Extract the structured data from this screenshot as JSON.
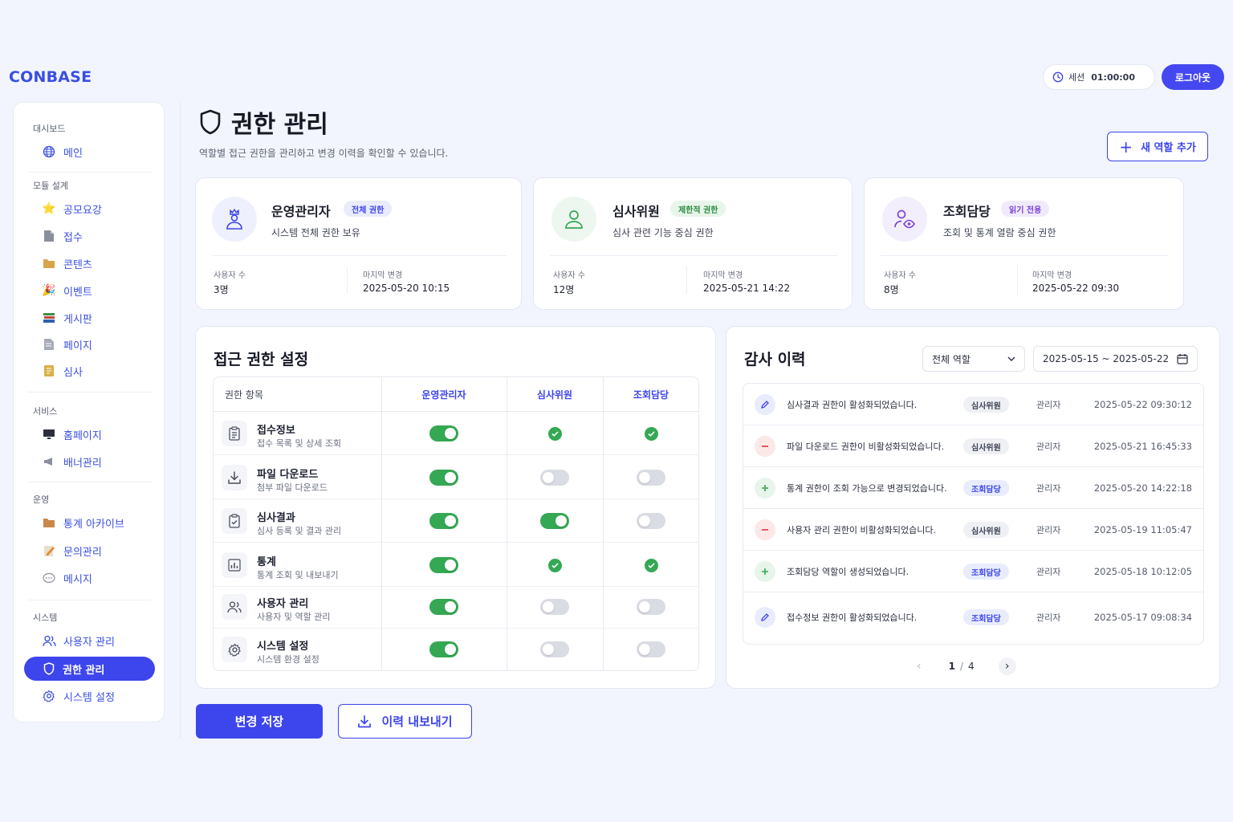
{
  "app": {
    "logo": "CONBASE"
  },
  "header": {
    "session_label": "세션",
    "session_time": "01:00:00",
    "logout_label": "로그아웃"
  },
  "sidebar": {
    "sections": [
      "대시보드",
      "모듈 설계",
      "서비스",
      "운영",
      "시스템"
    ],
    "items": [
      {
        "label": "메인",
        "icon": "globe-icon"
      },
      {
        "label": "공모요강",
        "icon": "star-icon"
      },
      {
        "label": "접수",
        "icon": "document-icon"
      },
      {
        "label": "콘텐츠",
        "icon": "folder-icon"
      },
      {
        "label": "이벤트",
        "icon": "party-icon"
      },
      {
        "label": "게시판",
        "icon": "books-icon"
      },
      {
        "label": "페이지",
        "icon": "page-icon"
      },
      {
        "label": "심사",
        "icon": "note-icon"
      },
      {
        "label": "홈페이지",
        "icon": "monitor-icon"
      },
      {
        "label": "배너관리",
        "icon": "megaphone-icon"
      },
      {
        "label": "통계 아카이브",
        "icon": "archive-icon"
      },
      {
        "label": "문의관리",
        "icon": "memo-icon"
      },
      {
        "label": "메시지",
        "icon": "speech-bubble-icon"
      },
      {
        "label": "사용자 관리",
        "icon": "users-icon"
      },
      {
        "label": "권한 관리",
        "icon": "shield-icon"
      },
      {
        "label": "시스템 설정",
        "icon": "gear-icon"
      }
    ],
    "active": "권한 관리"
  },
  "page": {
    "title": "권한 관리",
    "subtitle": "역할별 접근 권한을 관리하고 변경 이력을 확인할 수 있습니다.",
    "add_role_label": "새 역할 추가"
  },
  "roles": [
    {
      "name": "운영관리자",
      "badge": "전체 권한",
      "desc": "시스템 전체 권한 보유",
      "users_label": "사용자 수",
      "users": "3명",
      "changed_label": "마지막 변경",
      "changed": "2025-05-20 10:15"
    },
    {
      "name": "심사위원",
      "badge": "제한적 권한",
      "desc": "심사 관련 기능 중심 권한",
      "users_label": "사용자 수",
      "users": "12명",
      "changed_label": "마지막 변경",
      "changed": "2025-05-21 14:22"
    },
    {
      "name": "조회담당",
      "badge": "읽기 전용",
      "desc": "조회 및 통계 열람 중심 권한",
      "users_label": "사용자 수",
      "users": "8명",
      "changed_label": "마지막 변경",
      "changed": "2025-05-22 09:30"
    }
  ],
  "access": {
    "title": "접근 권한 설정",
    "columns": [
      "권한 항목",
      "운영관리자",
      "심사위원",
      "조회담당"
    ],
    "rows": [
      {
        "name": "접수정보",
        "sub": "접수 목록 및 상세 조회",
        "icon": "clipboard-list-icon",
        "states": [
          "toggle-on",
          "check",
          "check"
        ]
      },
      {
        "name": "파일 다운로드",
        "sub": "첨부 파일 다운로드",
        "icon": "download-icon",
        "states": [
          "toggle-on",
          "toggle-off",
          "toggle-off"
        ]
      },
      {
        "name": "심사결과",
        "sub": "심사 등록 및 결과 관리",
        "icon": "clipboard-check-icon",
        "states": [
          "toggle-on",
          "toggle-on",
          "toggle-off"
        ]
      },
      {
        "name": "통계",
        "sub": "통계 조회 및 내보내기",
        "icon": "bar-chart-icon",
        "states": [
          "toggle-on",
          "check",
          "check"
        ]
      },
      {
        "name": "사용자 관리",
        "sub": "사용자 및 역할 관리",
        "icon": "users-icon",
        "states": [
          "toggle-on",
          "toggle-off",
          "toggle-off"
        ]
      },
      {
        "name": "시스템 설정",
        "sub": "시스템 환경 설정",
        "icon": "gear-icon",
        "states": [
          "toggle-on",
          "toggle-off",
          "toggle-off"
        ]
      }
    ]
  },
  "audit": {
    "title": "감사 이력",
    "role_filter": "전체 역할",
    "date_range": "2025-05-15 ~ 2025-05-22",
    "entries": [
      {
        "type": "edit",
        "message": "심사결과 권한이 활성화되었습니다.",
        "role": "심사위원",
        "user": "관리자",
        "time": "2025-05-22 09:30:12"
      },
      {
        "type": "remove",
        "message": "파일 다운로드 권한이 비활성화되었습니다.",
        "role": "심사위원",
        "user": "관리자",
        "time": "2025-05-21 16:45:33"
      },
      {
        "type": "add",
        "message": "통계 권한이 조회 가능으로 변경되었습니다.",
        "role": "조회담당",
        "user": "관리자",
        "time": "2025-05-20 14:22:18"
      },
      {
        "type": "remove",
        "message": "사용자 관리 권한이 비활성화되었습니다.",
        "role": "심사위원",
        "user": "관리자",
        "time": "2025-05-19 11:05:47"
      },
      {
        "type": "add",
        "message": "조회담당 역할이 생성되었습니다.",
        "role": "조회담당",
        "user": "관리자",
        "time": "2025-05-18 10:12:05"
      },
      {
        "type": "edit",
        "message": "접수정보 권한이 활성화되었습니다.",
        "role": "조회담당",
        "user": "관리자",
        "time": "2025-05-17 09:08:34"
      }
    ],
    "page_current": "1",
    "page_sep": "/",
    "page_total": "4"
  },
  "actions": {
    "save_label": "변경 저장",
    "export_label": "이력 내보내기"
  },
  "colors": {
    "primary": "#3d45ec",
    "green": "#35a853",
    "red": "#e5484d"
  }
}
